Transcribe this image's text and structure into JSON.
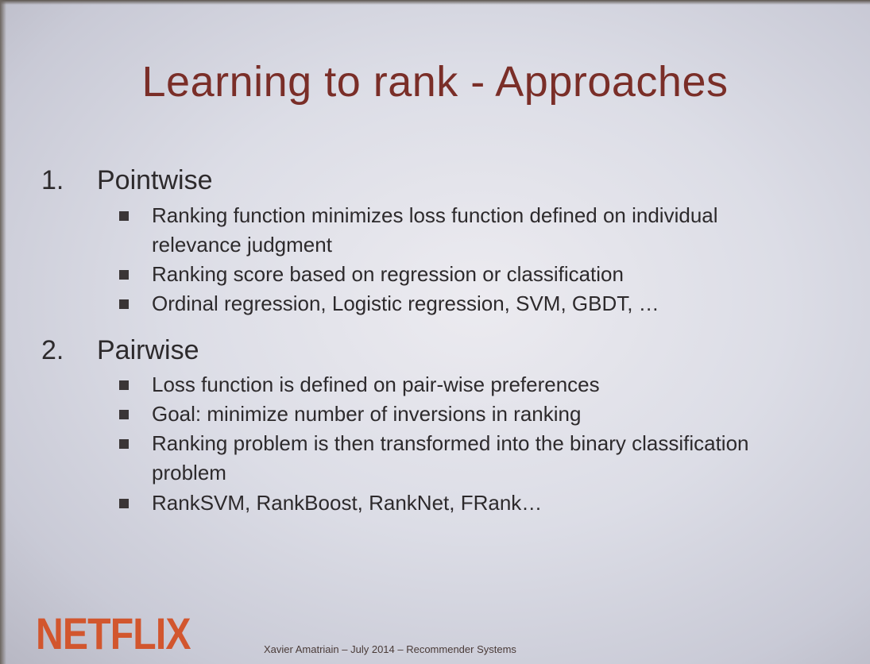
{
  "slide": {
    "title": "Learning to rank - Approaches",
    "sections": [
      {
        "number": "1.",
        "heading": "Pointwise",
        "bullets": [
          "Ranking function minimizes loss function defined on individual relevance judgment",
          "Ranking score based on regression or classification",
          "Ordinal regression, Logistic regression, SVM, GBDT, …"
        ]
      },
      {
        "number": "2.",
        "heading": "Pairwise",
        "bullets": [
          "Loss function is defined on pair-wise preferences",
          "Goal: minimize number of inversions in ranking",
          "Ranking problem is then transformed into the binary classification problem",
          "RankSVM, RankBoost, RankNet, FRank…"
        ]
      }
    ],
    "logo_text": "NETFLIX",
    "footer": "Xavier Amatriain – July 2014 – Recommender Systems",
    "colors": {
      "title": "#7a2e28",
      "body_text": "#2d2a2c",
      "logo": "#d2562e",
      "background": "#dcdde6"
    }
  }
}
